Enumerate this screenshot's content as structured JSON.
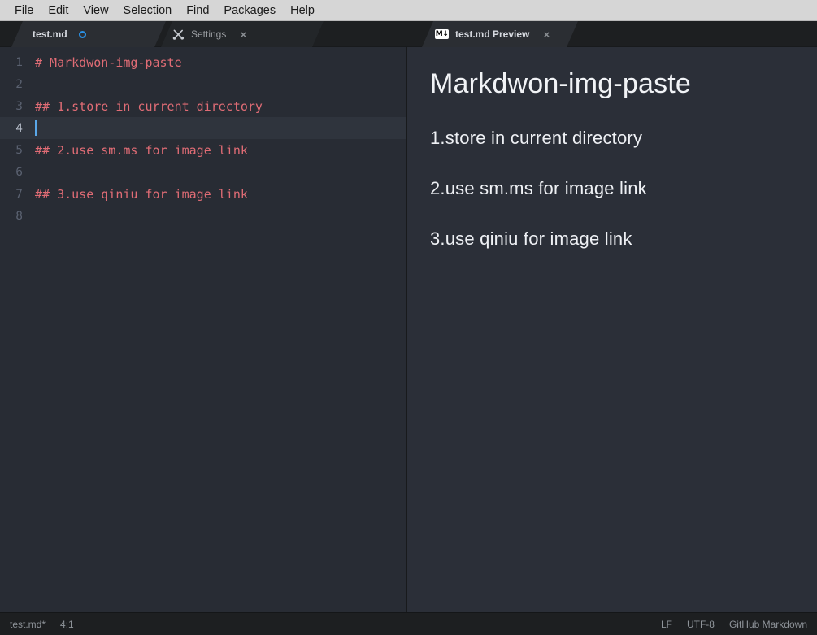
{
  "menubar": {
    "items": [
      {
        "label": "File"
      },
      {
        "label": "Edit"
      },
      {
        "label": "View"
      },
      {
        "label": "Selection"
      },
      {
        "label": "Find"
      },
      {
        "label": "Packages"
      },
      {
        "label": "Help"
      }
    ]
  },
  "tabs_left": [
    {
      "label": "test.md",
      "state": "active",
      "modified": true,
      "icon": "none"
    },
    {
      "label": "Settings",
      "state": "inactive",
      "modified": false,
      "icon": "tools-icon",
      "close": "×"
    }
  ],
  "tabs_right": [
    {
      "label": "test.md Preview",
      "state": "active",
      "modified": false,
      "icon": "markdown-icon",
      "icon_text": "M↓",
      "close": "×"
    }
  ],
  "editor": {
    "lines": [
      {
        "num": "1",
        "text": "# Markdwon-img-paste",
        "current": false
      },
      {
        "num": "2",
        "text": "",
        "current": false
      },
      {
        "num": "3",
        "text": "## 1.store in current directory",
        "current": false
      },
      {
        "num": "4",
        "text": "",
        "current": true
      },
      {
        "num": "5",
        "text": "## 2.use sm.ms for image link",
        "current": false
      },
      {
        "num": "6",
        "text": "",
        "current": false
      },
      {
        "num": "7",
        "text": "## 3.use qiniu for image link",
        "current": false
      },
      {
        "num": "8",
        "text": "",
        "current": false
      }
    ],
    "syntax_color": "#e06c75",
    "cursor_color": "#5aa7e8"
  },
  "preview": {
    "h1": "Markdwon-img-paste",
    "h2": [
      "1.store in current directory",
      "2.use sm.ms for image link",
      "3.use qiniu for image link"
    ]
  },
  "statusbar": {
    "file": "test.md*",
    "cursor_position": "4:1",
    "line_ending": "LF",
    "encoding": "UTF-8",
    "grammar": "GitHub Markdown"
  }
}
